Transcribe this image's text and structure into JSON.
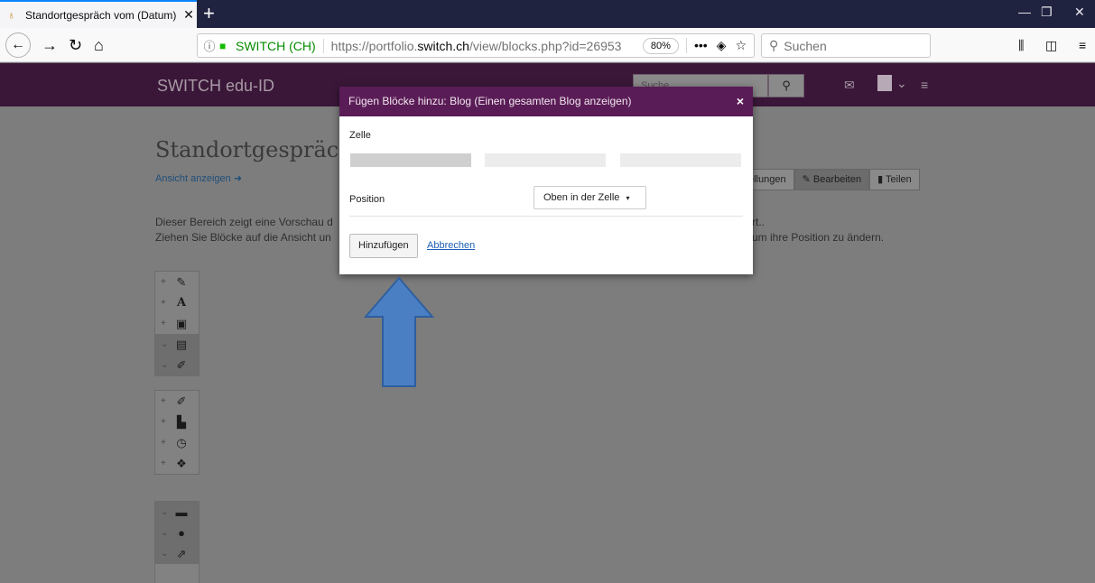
{
  "browser": {
    "tab_title": "Standortgespräch vom (Datum)",
    "tab_close": "✕",
    "new_tab": "+",
    "url_info": "ⓘ",
    "org_name": "SWITCH (CH)",
    "url_prefix": "https://portfolio.",
    "url_host": "switch.ch",
    "url_path": "/view/blocks.php?id=26953",
    "zoom": "80%",
    "more": "•••",
    "search_placeholder": "Suchen"
  },
  "site": {
    "brand": "SWITCH edu-ID",
    "search_placeholder": "Suche"
  },
  "page": {
    "title": "Standortgespräch v",
    "view_link": "Ansicht anzeigen",
    "buttons": [
      "ellungen",
      "Bearbeiten",
      "Teilen"
    ],
    "info_left_1": "Dieser Bereich zeigt eine Vorschau d",
    "info_left_2": "Ziehen Sie Blöcke auf die Ansicht un",
    "info_right_1": "rt..",
    "info_right_2": "um ihre Position zu ändern."
  },
  "modal": {
    "title": "Fügen Blöcke hinzu: Blog (Einen gesamten Blog anzeigen)",
    "close": "×",
    "cell_label": "Zelle",
    "position_label": "Position",
    "position_value": "Oben in der Zelle",
    "add_button": "Hinzufügen",
    "cancel_link": "Abbrechen"
  },
  "palette": [
    {
      "mv": "+",
      "icon": "✎",
      "name": "text-block-icon"
    },
    {
      "mv": "+",
      "icon": "A",
      "name": "heading-block-icon"
    },
    {
      "mv": "+",
      "icon": "▣",
      "name": "image-block-icon"
    },
    {
      "mv": "⌄",
      "icon": "▤",
      "name": "media-block-icon"
    },
    {
      "mv": "⌄",
      "icon": "✐",
      "name": "journal-block-icon"
    },
    {
      "mv": "+",
      "icon": "✐",
      "name": "blog-post-icon"
    },
    {
      "mv": "+",
      "icon": "▙",
      "name": "file-block-icon"
    },
    {
      "mv": "+",
      "icon": "◷",
      "name": "recent-posts-icon"
    },
    {
      "mv": "+",
      "icon": "❖",
      "name": "tags-block-icon"
    },
    {
      "mv": "⌄",
      "icon": "▬",
      "name": "resume-block-icon"
    },
    {
      "mv": "⌄",
      "icon": "●",
      "name": "profile-block-icon"
    },
    {
      "mv": "⌄",
      "icon": "⇗",
      "name": "external-block-icon"
    }
  ],
  "colors": {
    "header": "#3a1738",
    "modal_header": "#5a1c56",
    "arrow_fill": "#4a7fc4"
  }
}
